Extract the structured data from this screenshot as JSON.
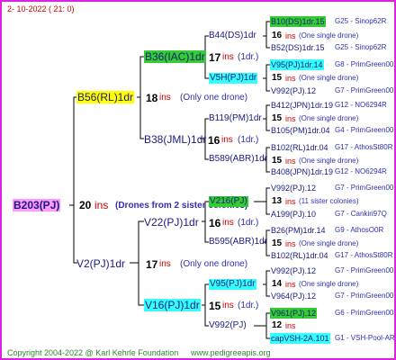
{
  "header": {
    "date": "2- 10-2022 ( 21: 0)"
  },
  "colors": {
    "border": "#e020e0",
    "yellow": "#ffff00",
    "green": "#33cc33",
    "cyan": "#33ffff",
    "magenta_box": "#ff99ff",
    "red": "#d00000",
    "blue": "#3030b0"
  },
  "root": {
    "label": "B203(PJ)",
    "ins_num": "20",
    "ins_word": "ins",
    "note": "(Drones from 2 sister colonies)"
  },
  "sire": {
    "label": "B56(RL)1dr",
    "ins_num": "18",
    "ins_word": "ins",
    "note": "(Only one drone)"
  },
  "dam": {
    "label": "V2(PJ)1dr",
    "ins_num": "17",
    "ins_word": "ins",
    "note": "(Only one drone)"
  },
  "gen3": [
    {
      "label": "B36(IAC)1dr",
      "ins_num": "17",
      "ins_word": "ins",
      "note": "(1dr.)"
    },
    {
      "label": "B38(JML)1dr",
      "ins_num": "16",
      "ins_word": "ins",
      "note": "(1dr.)"
    },
    {
      "label": "V22(PJ)1dr",
      "ins_num": "16",
      "ins_word": "ins",
      "note": "(1dr.)"
    },
    {
      "label": "V16(PJ)1dr",
      "ins_num": "15",
      "ins_word": "ins",
      "note": "(1dr.)"
    }
  ],
  "gen4": [
    {
      "label": "B44(DS)1dr"
    },
    {
      "label": "V5H(PJ)1dr"
    },
    {
      "label": "B119(PM)1dr"
    },
    {
      "label": "B589(ABR)1dr"
    },
    {
      "label": "V216(PJ)"
    },
    {
      "label": "B595(ABR)1dr"
    },
    {
      "label": "V95(PJ)1dr"
    },
    {
      "label": "V992(PJ)"
    }
  ],
  "gen5": [
    {
      "label": "B10(DS)1dr.15",
      "extra": "G25 - Sinop62R"
    },
    {
      "ins_num": "16",
      "ins_word": "ins",
      "note": "(One single drone)"
    },
    {
      "label": "B52(DS)1dr.15",
      "extra": "G25 - Sinop62R"
    },
    {
      "label": "V95(PJ)1dr.14",
      "extra": "G8 - PrimGreen00"
    },
    {
      "ins_num": "15",
      "ins_word": "ins",
      "note": "(One single drone)"
    },
    {
      "label": "V992(PJ).12",
      "extra": "G7 - PrimGreen00"
    },
    {
      "label": "B412(JPN)1dr.19",
      "extra": "G12 - NO6294R"
    },
    {
      "ins_num": "15",
      "ins_word": "ins",
      "note": "(One single drone)"
    },
    {
      "label": "B105(PM)1dr.04",
      "extra": "G4 - PrimGreen00"
    },
    {
      "label": "B102(RL)1dr.04",
      "extra": "G17 - AthosSt80R"
    },
    {
      "ins_num": "15",
      "ins_word": "ins",
      "note": "(One single drone)"
    },
    {
      "label": "B408(JPN)1dr.19",
      "extra": "G12 - NO6294R"
    },
    {
      "label": "V992(PJ).12",
      "extra": "G7 - PrimGreen00"
    },
    {
      "ins_num": "13",
      "ins_word": "ins",
      "note": "(11 sister colonies)"
    },
    {
      "label": "A199(PJ).10",
      "extra": "G7 - Cankiri97Q"
    },
    {
      "label": "B26(PM)1dr.14",
      "extra": "G9 - AthosO0R"
    },
    {
      "ins_num": "15",
      "ins_word": "ins",
      "note": "(One single drone)"
    },
    {
      "label": "B102(RL)1dr.04",
      "extra": "G17 - AthosSt80R"
    },
    {
      "label": "V992(PJ).12",
      "extra": "G7 - PrimGreen00"
    },
    {
      "ins_num": "14",
      "ins_word": "ins",
      "note": "(One single drone)"
    },
    {
      "label": "V964(PJ).12",
      "extra": "G7 - PrimGreen00"
    },
    {
      "label": "V961(PJ).12",
      "extra": "G6 - PrimGreen00"
    },
    {
      "ins_num": "12",
      "ins_word": "ins",
      "note": ""
    },
    {
      "label": "capVSH-2A.101",
      "extra": "G1 - VSH-Pool-AR"
    }
  ],
  "footer": {
    "copyright": "Copyright 2004-2022 @ Karl Kehrle Foundation",
    "url": "www.pedigreeapis.org"
  }
}
